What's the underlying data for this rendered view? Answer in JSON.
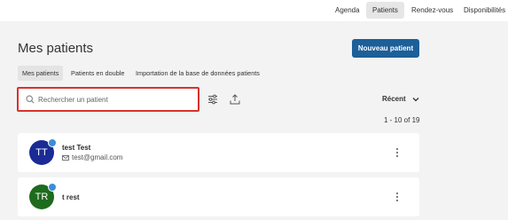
{
  "nav": {
    "items": [
      {
        "label": "Agenda",
        "active": false
      },
      {
        "label": "Patients",
        "active": true
      },
      {
        "label": "Rendez-vous",
        "active": false
      },
      {
        "label": "Disponibilités",
        "active": false
      }
    ]
  },
  "header": {
    "title": "Mes patients",
    "new_patient_label": "Nouveau patient"
  },
  "tabs": [
    {
      "label": "Mes patients",
      "active": true
    },
    {
      "label": "Patients en double",
      "active": false
    },
    {
      "label": "Importation de la base de données patients",
      "active": false
    }
  ],
  "search": {
    "placeholder": "Rechercher un patient",
    "value": ""
  },
  "toolbar": {
    "filter_icon": "sliders-icon",
    "export_icon": "upload-icon",
    "sort_label": "Récent"
  },
  "pagination": {
    "text": "1 - 10 of 19"
  },
  "patients": [
    {
      "initials": "TT",
      "name": "test Test",
      "email": "test@gmail.com",
      "avatar_color": "#1a2b96"
    },
    {
      "initials": "TR",
      "name": "t rest",
      "email": "",
      "avatar_color": "#1e6b1e"
    }
  ],
  "colors": {
    "accent": "#1c5f99",
    "highlight": "#d9322b",
    "badge": "#3a8ed8"
  }
}
